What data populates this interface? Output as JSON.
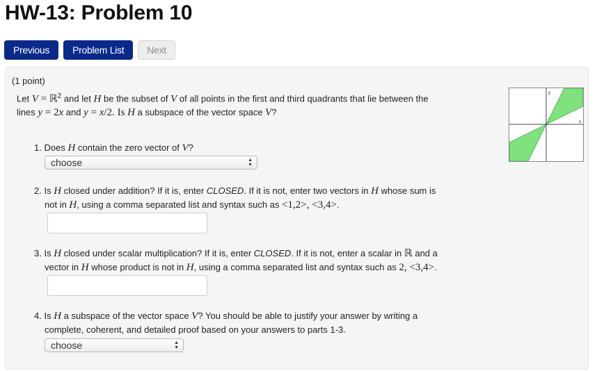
{
  "page": {
    "title": "HW-13: Problem 10"
  },
  "nav": {
    "previous_label": "Previous",
    "problem_list_label": "Problem List",
    "next_label": "Next"
  },
  "problem": {
    "points": "(1 point)",
    "statement": {
      "t1": "Let ",
      "m1": "V",
      "t2": " = ",
      "m2": "ℝ",
      "sup": "2",
      "t3": " and let ",
      "m3": "H",
      "t4": " be the subset of ",
      "m4": "V",
      "t5": " of all points in the first and third quadrants that lie between the",
      "t6": "lines ",
      "m5": "y",
      "t7": " = 2",
      "m6": "x",
      "t8": " and ",
      "m7": "y",
      "t9": " = ",
      "m8": "x",
      "t10": "/2. Is ",
      "m9": "H",
      "t11": " a subspace of the vector space ",
      "m10": "V",
      "t12": "?"
    },
    "graph": {
      "x_label": "x",
      "y_label": "y",
      "fill_color": "#7fe27f"
    },
    "questions": [
      {
        "number": "1.",
        "text_a": "Does ",
        "m1": "H",
        "text_b": " contain the zero vector of ",
        "m2": "V",
        "text_c": "?",
        "answer_type": "select",
        "select_value": "choose"
      },
      {
        "number": "2.",
        "text_a": "Is ",
        "m1": "H",
        "text_b": " closed under addition? If it is, enter ",
        "em": "CLOSED",
        "text_c": ". If it is not, enter two vectors in ",
        "m2": "H",
        "text_d": " whose sum is",
        "line2_a": "not in ",
        "m3": "H",
        "line2_b": ", using a comma separated list and syntax such as ",
        "code": "<1,2>, <3,4>",
        "line2_c": ".",
        "answer_type": "text",
        "input_value": ""
      },
      {
        "number": "3.",
        "text_a": "Is ",
        "m1": "H",
        "text_b": " closed under scalar multiplication? If it is, enter ",
        "em": "CLOSED",
        "text_c": ". If it is not, enter a scalar in ",
        "m2": "ℝ",
        "text_d": " and a",
        "line2_a": "vector in ",
        "m3": "H",
        "line2_b": " whose product is not in ",
        "m4": "H",
        "line2_c": ", using a comma separated list and syntax such as ",
        "code": "2, <3,4>",
        "line2_d": ".",
        "answer_type": "text",
        "input_value": ""
      },
      {
        "number": "4.",
        "text_a": "Is ",
        "m1": "H",
        "text_b": " a subspace of the vector space ",
        "m2": "V",
        "text_c": "? You should be able to justify your answer by writing a",
        "line2": "complete, coherent, and detailed proof based on your answers to parts 1-3.",
        "answer_type": "select",
        "select_value": "choose"
      }
    ]
  }
}
